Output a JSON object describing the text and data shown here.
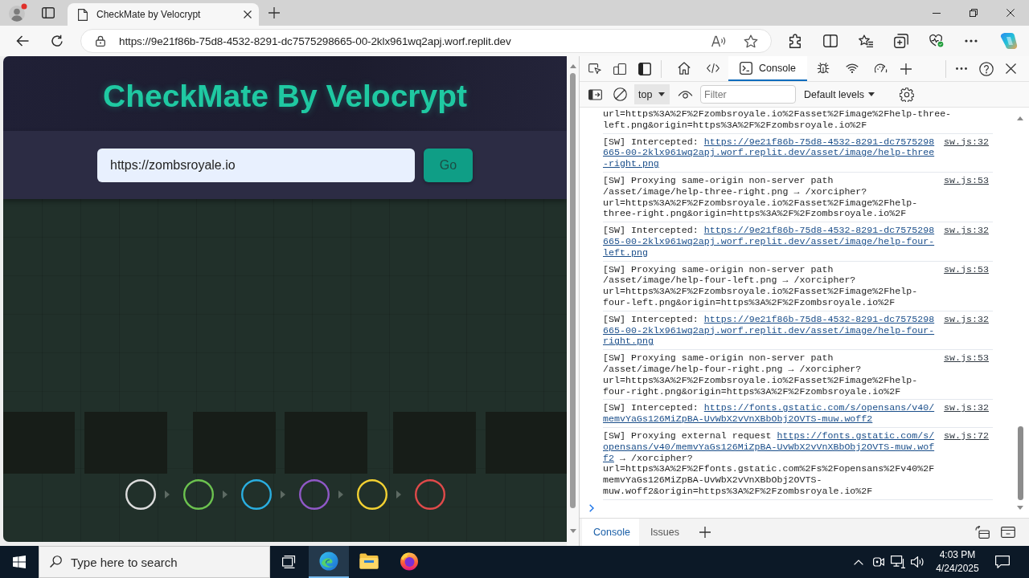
{
  "browser": {
    "tab": {
      "title": "CheckMate by Velocrypt",
      "selected": true
    },
    "address": "https://9e21f86b-75d8-4532-8291-dc7575298665-00-2klx961wq2apj.worf.replit.dev"
  },
  "page": {
    "title": "CheckMate By Velocrypt",
    "url_input": {
      "value": "https://zombsroyale.io"
    },
    "go_button": "Go",
    "steps": [
      {
        "color": "#dcdcdc"
      },
      {
        "color": "#6cc24f"
      },
      {
        "color": "#2aaee0"
      },
      {
        "color": "#8f58c6"
      },
      {
        "color": "#f2d032"
      },
      {
        "color": "#e04a4a"
      }
    ]
  },
  "devtools": {
    "tabs": [
      {
        "kind": "home",
        "selected": false
      },
      {
        "kind": "code",
        "selected": false
      },
      {
        "kind": "console",
        "label": "Console",
        "selected": true
      },
      {
        "kind": "bug",
        "selected": false
      },
      {
        "kind": "wifi",
        "selected": false
      },
      {
        "kind": "gauge",
        "selected": false
      }
    ],
    "context": "top",
    "filter": {
      "placeholder": "Filter"
    },
    "levels": "Default levels",
    "messages": [
      {
        "parts": [
          {
            "kind": "text",
            "text": "url=https%3A%2F%2Fzombsroyale.io%2Fasset%2Fimage%2Fhelp-three-left.png&origin=https%3A%2F%2Fzombsroyale.io%2F"
          }
        ]
      },
      {
        "source": "sw.js:32",
        "parts": [
          {
            "kind": "text",
            "text": "[SW] Intercepted:"
          },
          {
            "kind": "link",
            "text": "https://9e21f86b-75d8-4532-8291-dc7575298665-00-2klx961wq2apj.worf.replit.dev/asset/image/help-three-right.png"
          }
        ]
      },
      {
        "source": "sw.js:53",
        "parts": [
          {
            "kind": "text",
            "text": "[SW] Proxying same-origin non-server path /asset/image/help-three-right.png → /xorcipher?url=https%3A%2F%2Fzombsroyale.io%2Fasset%2Fimage%2Fhelp-three-right.png&origin=https%3A%2F%2Fzombsroyale.io%2F"
          }
        ]
      },
      {
        "source": "sw.js:32",
        "parts": [
          {
            "kind": "text",
            "text": "[SW] Intercepted:"
          },
          {
            "kind": "link",
            "text": "https://9e21f86b-75d8-4532-8291-dc7575298665-00-2klx961wq2apj.worf.replit.dev/asset/image/help-four-left.png"
          }
        ]
      },
      {
        "source": "sw.js:53",
        "parts": [
          {
            "kind": "text",
            "text": "[SW] Proxying same-origin non-server path /asset/image/help-four-left.png → /xorcipher?url=https%3A%2F%2Fzombsroyale.io%2Fasset%2Fimage%2Fhelp-four-left.png&origin=https%3A%2F%2Fzombsroyale.io%2F"
          }
        ]
      },
      {
        "source": "sw.js:32",
        "parts": [
          {
            "kind": "text",
            "text": "[SW] Intercepted:"
          },
          {
            "kind": "link",
            "text": "https://9e21f86b-75d8-4532-8291-dc7575298665-00-2klx961wq2apj.worf.replit.dev/asset/image/help-four-right.png"
          }
        ]
      },
      {
        "source": "sw.js:53",
        "parts": [
          {
            "kind": "text",
            "text": "[SW] Proxying same-origin non-server path /asset/image/help-four-right.png → /xorcipher?url=https%3A%2F%2Fzombsroyale.io%2Fasset%2Fimage%2Fhelp-four-right.png&origin=https%3A%2F%2Fzombsroyale.io%2F"
          }
        ]
      },
      {
        "source": "sw.js:32",
        "parts": [
          {
            "kind": "text",
            "text": "[SW] Intercepted:"
          },
          {
            "kind": "link",
            "text": "https://fonts.gstatic.com/s/opensans/v40/memvYaGs126MiZpBA-UvWbX2vVnXBbObj2OVTS-muw.woff2"
          }
        ]
      },
      {
        "source": "sw.js:72",
        "parts": [
          {
            "kind": "text",
            "text": "[SW] Proxying external request"
          },
          {
            "kind": "link",
            "text": "https://fonts.gstatic.com/s/opensans/v40/memvYaGs126MiZpBA-UvWbX2vVnXBbObj2OVTS-muw.woff2"
          },
          {
            "kind": "text",
            "text": "→ /xorcipher?url=https%3A%2F%2Ffonts.gstatic.com%2Fs%2Fopensans%2Fv40%2FmemvYaGs126MiZpBA-UvWbX2vVnXBbObj2OVTS-muw.woff2&origin=https%3A%2F%2Fzombsroyale.io%2F"
          }
        ]
      }
    ],
    "drawer_tabs": [
      {
        "label": "Console",
        "selected": true
      },
      {
        "label": "Issues",
        "selected": false
      }
    ]
  },
  "taskbar": {
    "search": {
      "placeholder": "Type here to search"
    },
    "apps": [
      {
        "kind": "browser",
        "active": true
      },
      {
        "kind": "folder",
        "active": false
      },
      {
        "kind": "fox",
        "active": false
      }
    ],
    "time": "4:03 PM",
    "date": "4/24/2025"
  }
}
